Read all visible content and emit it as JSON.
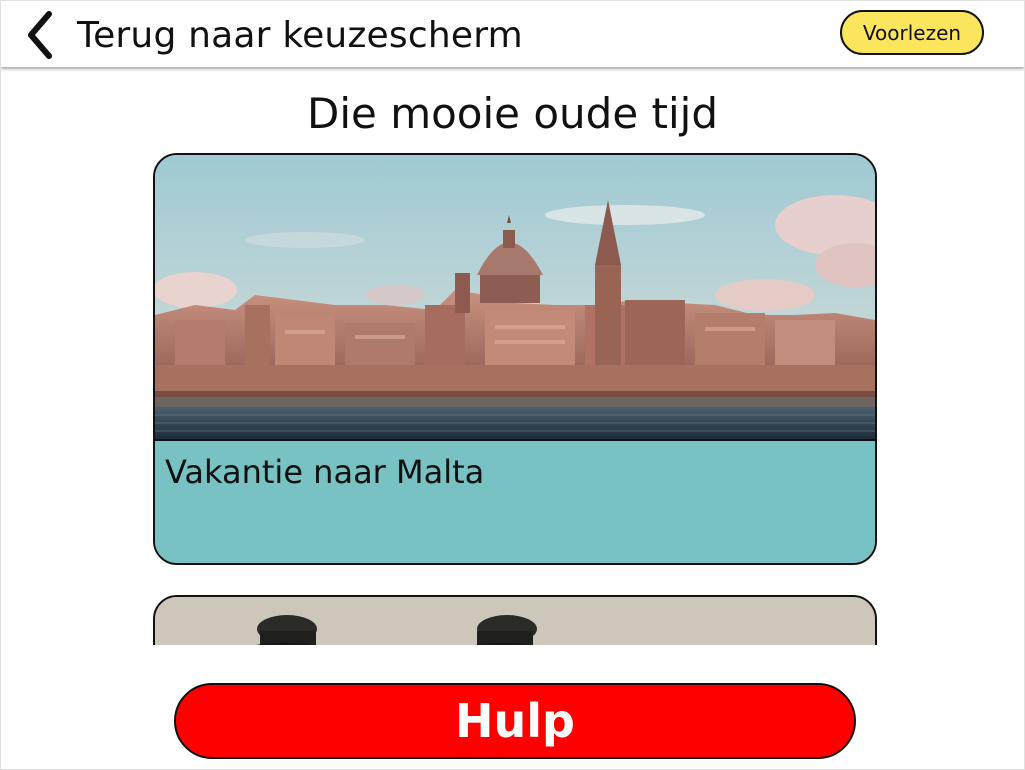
{
  "header": {
    "back_label": "Terug naar keuzescherm",
    "read_aloud_label": "Voorlezen",
    "back_icon": "chevron-left-icon"
  },
  "page": {
    "title": "Die mooie oude tijd"
  },
  "cards": [
    {
      "caption": "Vakantie naar Malta",
      "image": "valletta-skyline-photo",
      "caption_color": "#78c2c4"
    },
    {
      "caption": "",
      "image": "vintage-soldiers-photo"
    }
  ],
  "help": {
    "label": "Hulp",
    "color": "#ff0000"
  },
  "colors": {
    "read_aloud_button": "#fbe55d",
    "caption_background": "#78c2c4",
    "help_button": "#ff0000"
  }
}
